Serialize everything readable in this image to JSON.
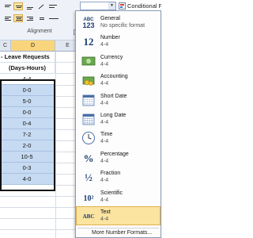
{
  "ribbon": {
    "group_label": "Alignment",
    "launcher_glyph": "↘"
  },
  "format_combo": {
    "value": "",
    "arrow_glyph": "▼"
  },
  "conditional_formatting": {
    "label": "Conditional For"
  },
  "sheet": {
    "columns": [
      {
        "name": "C",
        "selected": false
      },
      {
        "name": "D",
        "selected": true
      },
      {
        "name": "E",
        "selected": false
      }
    ],
    "header_row1": "- Leave Requests",
    "header_row2": "(Days-Hours)",
    "cells": [
      "4-4",
      "0-0",
      "5-0",
      "0-0",
      "0-4",
      "7-2",
      "2-0",
      "10-5",
      "0-3",
      "4-0"
    ]
  },
  "number_format_menu": {
    "items": [
      {
        "icon": "ABC\n123",
        "title": "General",
        "sample": "No specific format"
      },
      {
        "icon": "12",
        "title": "Number",
        "sample": "4-4"
      },
      {
        "icon": "currency",
        "title": "Currency",
        "sample": "4-4"
      },
      {
        "icon": "accounting",
        "title": "Accounting",
        "sample": " 4-4"
      },
      {
        "icon": "short-date",
        "title": "Short Date",
        "sample": "4-4"
      },
      {
        "icon": "long-date",
        "title": "Long Date",
        "sample": "4-4"
      },
      {
        "icon": "clock",
        "title": "Time",
        "sample": "4-4"
      },
      {
        "icon": "%",
        "title": "Percentage",
        "sample": "4-4"
      },
      {
        "icon": "½",
        "title": "Fraction",
        "sample": "4-4"
      },
      {
        "icon": "10²",
        "title": "Scientific",
        "sample": "4-4"
      },
      {
        "icon": "ABC",
        "title": "Text",
        "sample": "4-4"
      }
    ],
    "highlighted_index": 10,
    "more_label": "More Number Formats..."
  }
}
